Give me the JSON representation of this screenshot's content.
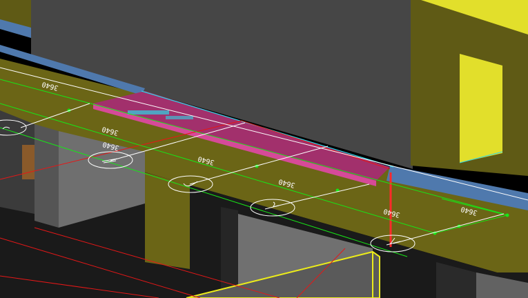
{
  "viewport": {
    "name": "3D CAD model viewport",
    "colors": {
      "background": "#000000",
      "slab": "#6b6516",
      "wall_dark": "#464646",
      "yellow_mass": "#5f5a15",
      "yellow_bright": "#e2df2b",
      "ledge_blue": "#4f79ad",
      "beam_magenta": "#a2306c",
      "grid_green": "#17e617",
      "dim_white": "#ffffff",
      "section_red": "#e61717",
      "cyan_edge": "#2ed6e6"
    }
  },
  "dimensions": [
    {
      "text": "3640"
    },
    {
      "text": "3640"
    },
    {
      "text": "3640"
    },
    {
      "text": "3640"
    },
    {
      "text": "3640"
    },
    {
      "text": "3640"
    },
    {
      "text": "3640"
    }
  ],
  "grid_bubbles": [
    {
      "icon": "grid-bubble-icon"
    },
    {
      "icon": "grid-bubble-icon"
    },
    {
      "icon": "grid-bubble-icon"
    },
    {
      "icon": "grid-bubble-icon"
    },
    {
      "icon": "grid-bubble-icon"
    }
  ]
}
